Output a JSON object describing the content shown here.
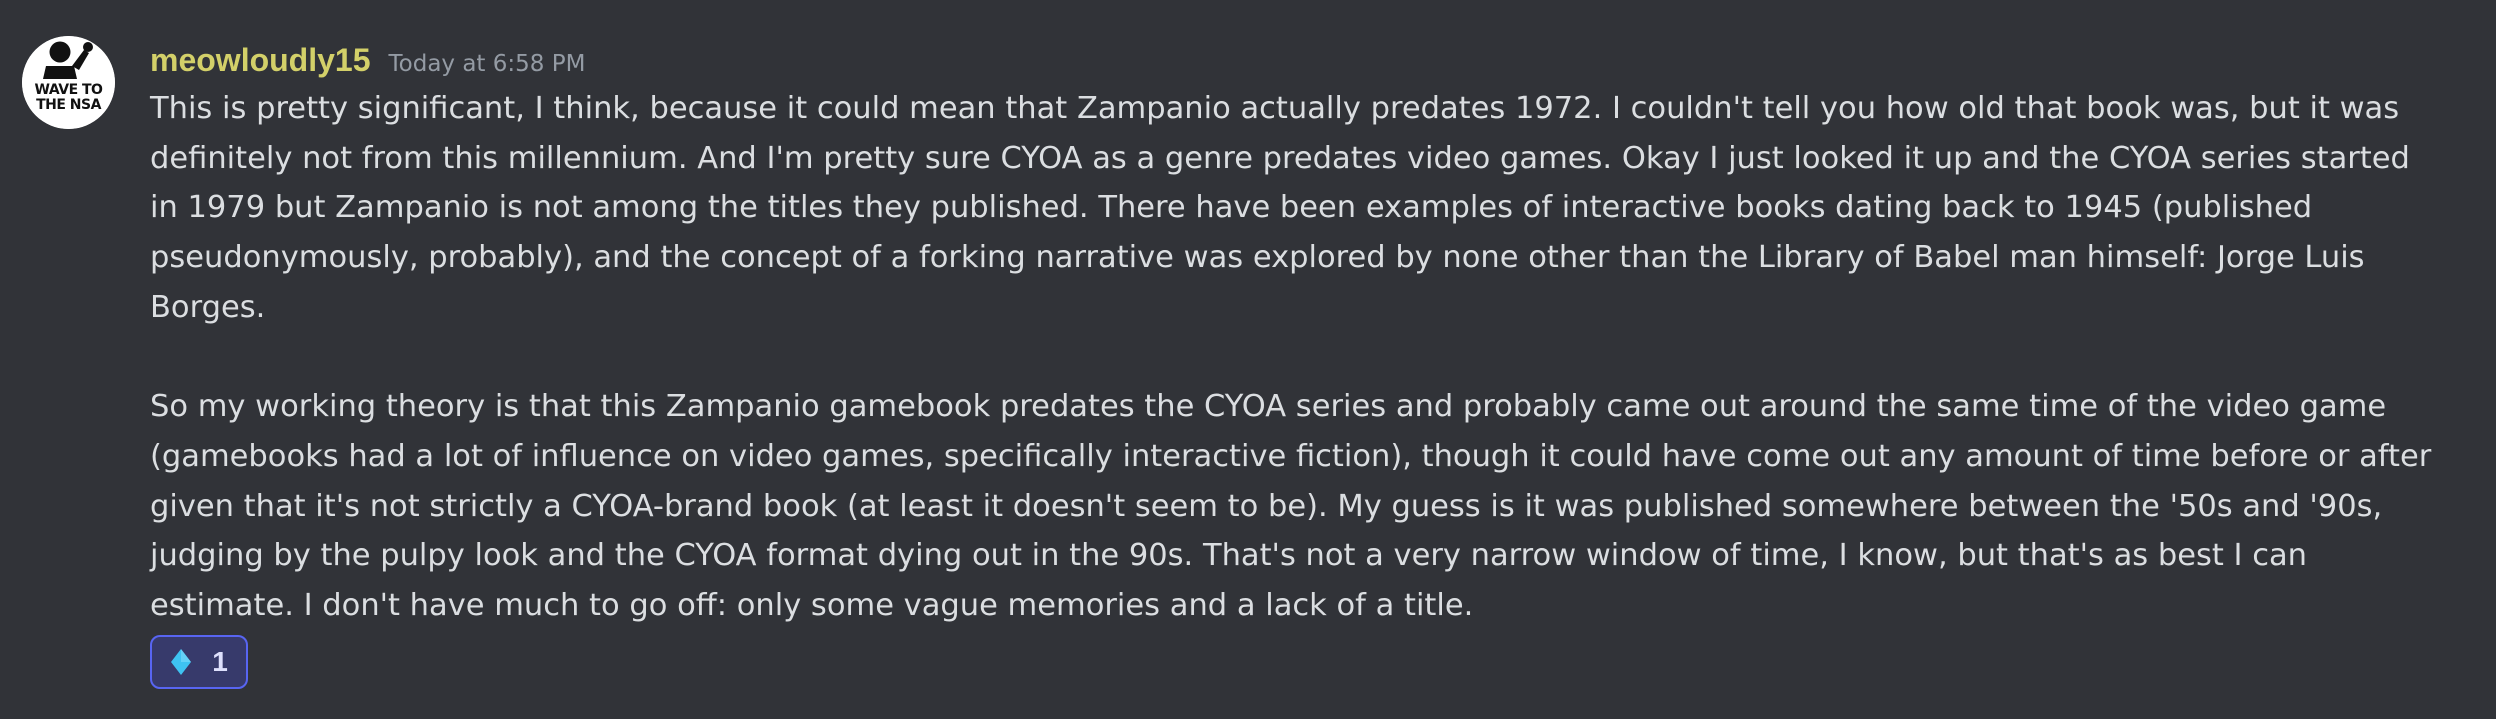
{
  "message": {
    "author": {
      "username": "meowloudly15",
      "avatar_text": "WAVE TO THE NSA",
      "username_color": "#d3d069"
    },
    "timestamp": "Today at 6:58 PM",
    "paragraphs": [
      "This is pretty significant, I think, because it could mean that Zampanio actually predates 1972. I couldn't tell you how old that book was, but it was definitely not from this millennium. And I'm pretty sure CYOA as a genre predates video games. Okay I just looked it up and the CYOA series started in 1979 but Zampanio is not among the titles they published. There have been examples of interactive books dating back to 1945 (published pseudonymously, probably), and the concept of a forking narrative was explored by none other than the Library of Babel man himself: Jorge Luis Borges.",
      "So my working theory is that this Zampanio gamebook predates the CYOA series and probably came out around the same time of the video game (gamebooks had a lot of influence on video games, specifically interactive fiction), though it could have come out any amount of time before or after given that it's not strictly a CYOA-brand book (at least it doesn't seem to be). My guess is it was published somewhere between the '50s and '90s, judging by the pulpy look and the CYOA format dying out in the 90s. That's not a very narrow window of time, I know, but that's as best I can estimate. I don't have much to go off: only some vague memories and a lack of a title."
    ],
    "reactions": [
      {
        "emoji": "small-blue-diamond-icon",
        "count": "1",
        "reacted": true
      }
    ]
  },
  "colors": {
    "background": "#313338",
    "text": "#dbdee1",
    "timestamp": "#949ba4",
    "reaction_border": "#5865f2",
    "reaction_bg": "#373a6b",
    "diamond": "#3ec3f2"
  }
}
